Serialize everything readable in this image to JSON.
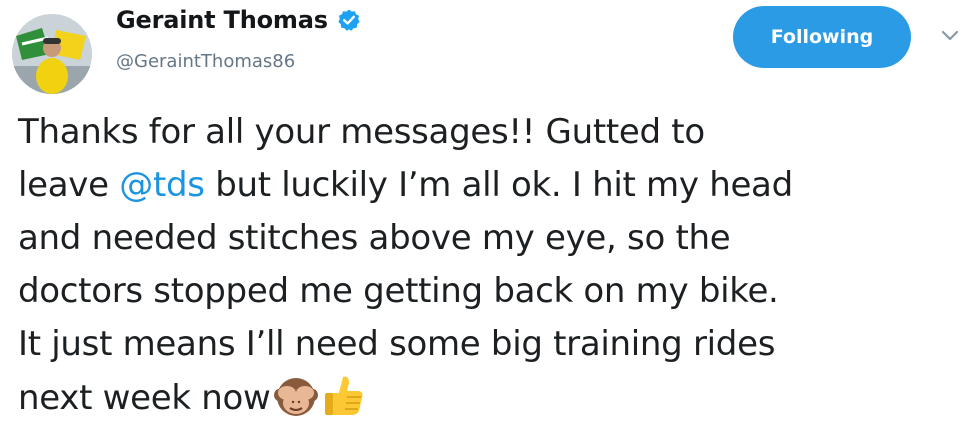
{
  "tweet": {
    "display_name": "Geraint Thomas",
    "handle": "@GeraintThomas86",
    "follow_label": "Following",
    "text_lines": [
      "Thanks for all your messages!! Gutted to",
      "but luckily I’m all ok. I hit my head",
      "and needed stitches above my eye, so the",
      "doctors stopped me getting back on my bike.",
      "It just means I’ll need some big training rides",
      "next week now"
    ],
    "line2_prefix": "leave ",
    "mention": "@tds",
    "emojis": [
      "see-no-evil-monkey-icon",
      "thumbs-up-icon"
    ]
  },
  "colors": {
    "accent": "#1b95e0",
    "follow_button": "#2b9be6",
    "handle": "#657786",
    "text": "#1c2022"
  }
}
